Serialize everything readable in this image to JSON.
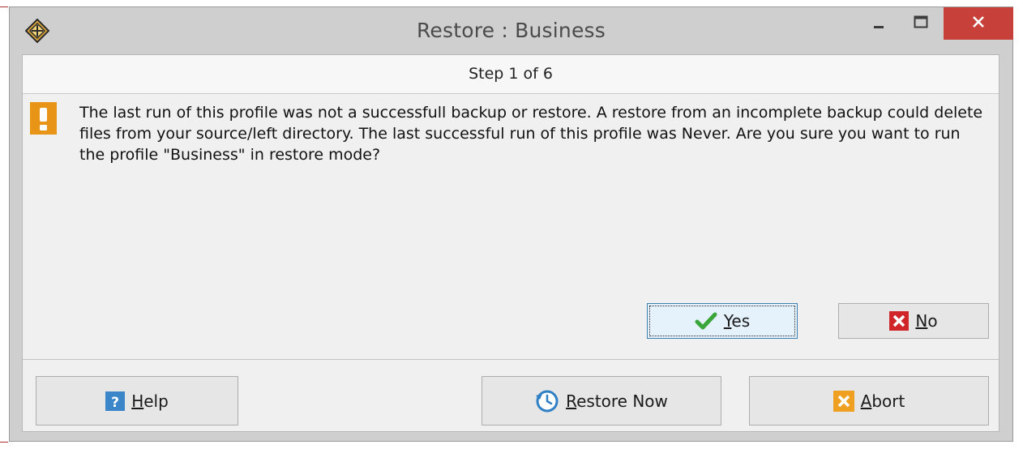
{
  "window": {
    "title": "Restore : Business",
    "icon": "app-move-icon",
    "controls": {
      "minimize_icon": "minimize-icon",
      "maximize_icon": "maximize-icon",
      "close_icon": "close-icon",
      "close_color": "#c7413a"
    }
  },
  "step": {
    "label": "Step 1 of 6"
  },
  "warning": {
    "icon": "warning-icon",
    "icon_glyph": "!",
    "icon_color": "#e89416",
    "text": "The last run of this profile was not a successfull backup or restore. A restore from an incomplete backup could delete files from your source/left directory. The last successful run of this profile was Never. Are you sure you want to run the profile \"Business\" in restore mode?"
  },
  "confirm": {
    "yes": {
      "mnemonic": "Y",
      "rest": "es",
      "icon": "check-icon",
      "icon_color": "#3aa63a"
    },
    "no": {
      "mnemonic": "N",
      "rest": "o",
      "icon": "x-icon",
      "icon_color": "#d0262a"
    }
  },
  "footer": {
    "help": {
      "mnemonic": "H",
      "rest": "elp",
      "icon": "help-icon",
      "icon_glyph": "?",
      "icon_color": "#3a86c8"
    },
    "restore_now": {
      "mnemonic": "R",
      "rest": "estore Now",
      "icon": "restore-clock-icon",
      "icon_color": "#2f7fc4"
    },
    "abort": {
      "mnemonic": "A",
      "rest": "bort",
      "icon": "abort-icon",
      "icon_color": "#f0a020"
    }
  }
}
